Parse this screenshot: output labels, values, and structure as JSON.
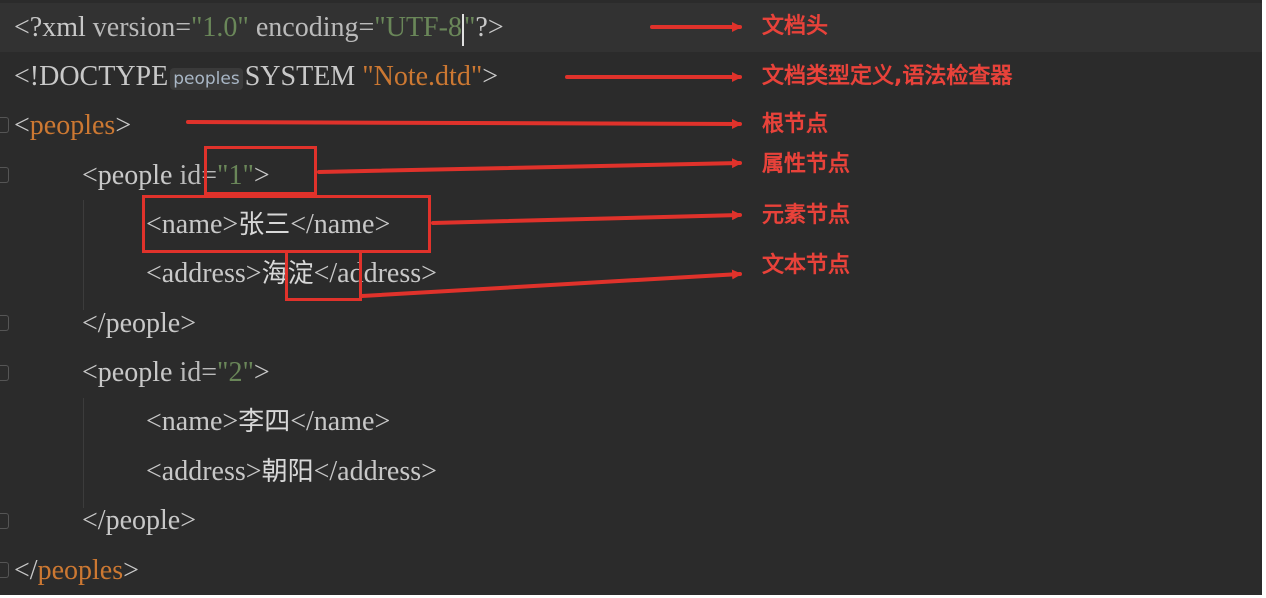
{
  "code": {
    "line1": {
      "open": "<?xml",
      "attr1": "version=",
      "val1": "\"1.0\"",
      "attr2": "encoding=",
      "val2a": "\"UTF-8",
      "val2b": "\"",
      "close": "?>"
    },
    "line2": {
      "open": "<!DOCTYPE",
      "badge": "peoples",
      "keyword": "SYSTEM",
      "value": "\"Note.dtd\"",
      "close": ">"
    },
    "line3": {
      "lt": "<",
      "name": "peoples",
      "gt": ">"
    },
    "line4": {
      "open": "<people",
      "attr": "id=",
      "value": "\"1\"",
      "close": ">"
    },
    "line5": {
      "open": "<name>",
      "text": "张三",
      "close": "</name>"
    },
    "line6": {
      "open": "<address>",
      "text": "海淀",
      "close": "</address>"
    },
    "line7": {
      "tag": "</people>"
    },
    "line8": {
      "open": "<people",
      "attr": "id=",
      "value": "\"2\"",
      "close": ">"
    },
    "line9": {
      "open": "<name>",
      "text": "李四",
      "close": "</name>"
    },
    "line10": {
      "open": "<address>",
      "text": "朝阳",
      "close": "</address>"
    },
    "line11": {
      "tag": "</people>"
    },
    "line12": {
      "lt": "</",
      "name": "peoples",
      "gt": ">"
    }
  },
  "annotations": {
    "doc_header": "文档头",
    "doctype": "文档类型定义,语法检查器",
    "root_node": "根节点",
    "attribute_node": "属性节点",
    "element_node": "元素节点",
    "text_node": "文本节点"
  },
  "colors": {
    "editor_bg": "#2b2b2b",
    "annotation_red": "#e0322b",
    "string_green": "#6a8759",
    "root_orange": "#cc7832"
  }
}
